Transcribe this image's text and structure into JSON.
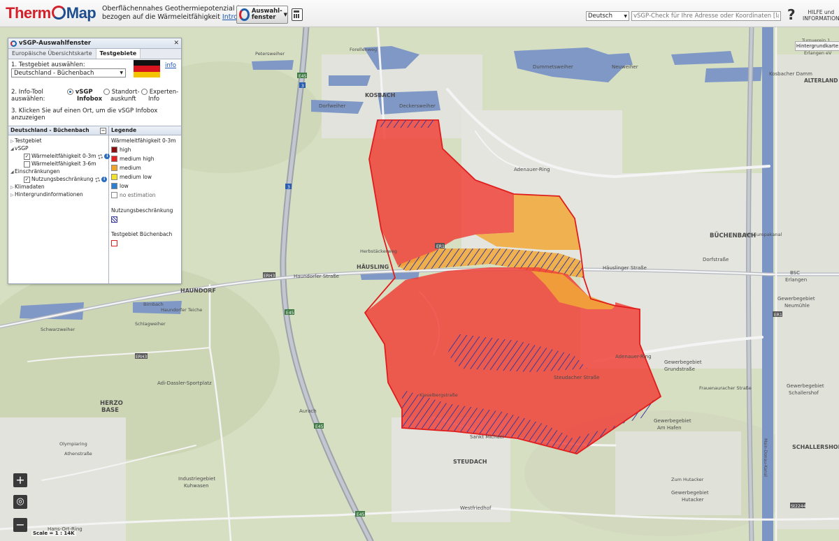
{
  "header": {
    "logo_part1": "Therm",
    "logo_part2": "Map",
    "subtitle_line1": "Oberflächennahes Geothermiepotenzial (vSGP)",
    "subtitle_line2": "bezogen auf die Wärmeleitfähigkeit",
    "intro_link": "Intro anzeigen",
    "auswahl_label_1": "Auswahl-",
    "auswahl_label_2": "fenster",
    "language": "Deutsch",
    "search_placeholder": "vSGP-Check für Ihre Adresse oder Koordinaten [lat,long]",
    "help_1": "HILFE und",
    "help_2": "INFORMATION",
    "background_map_button": "Hintergrundkarte"
  },
  "panel": {
    "title": "vSGP-Auswahlfenster",
    "tabs": [
      "Europäische Übersichtskarte",
      "Testgebiete"
    ],
    "step1": "1. Testgebiet auswählen:",
    "selected_area": "Deutschland - Büchenbach",
    "info_link": "info",
    "step2_a": "2. Info-Tool",
    "step2_b": "auswählen:",
    "tool_options": [
      {
        "l1": "vSGP",
        "l2": "Infobox"
      },
      {
        "l1": "Standort-",
        "l2": "auskunft"
      },
      {
        "l1": "Experten-",
        "l2": "Info"
      }
    ],
    "step3": "3. Klicken Sie auf einen Ort, um die vSGP Infobox anzuzeigen",
    "tree_title": "Deutschland - Büchenbach",
    "tree": {
      "testgebiet": "Testgebiet",
      "vsgp": "vSGP",
      "w03": "Wärmeleitfähigkeit 0-3m",
      "w36": "Wärmeleitfähigkeit 3-6m",
      "einschraenkungen": "Einschränkungen",
      "nutzung": "Nutzungsbeschränkung",
      "klimadaten": "Klimadaten",
      "hintergrund": "Hintergrundinformationen"
    },
    "legend_title": "Legende",
    "legend_subtitle": "Wärmeleitfähigkeit 0-3m",
    "legend_items": [
      {
        "label": "high",
        "color": "#8b0f0f"
      },
      {
        "label": "medium high",
        "color": "#e42222"
      },
      {
        "label": "medium",
        "color": "#f0a52a"
      },
      {
        "label": "medium low",
        "color": "#f3e22c"
      },
      {
        "label": "low",
        "color": "#2e7fd0"
      },
      {
        "label": "no estimation",
        "color": "#ffffff"
      }
    ],
    "legend_restriction": "Nutzungsbeschränkung",
    "legend_testarea": "Testgebiet Büchenbach"
  },
  "map": {
    "scale": "Scale = 1 : 14K",
    "labels": {
      "kosbach": "KOSBACH",
      "buechenbach": "BÜCHENBACH",
      "haeusling": "HÄUSLING",
      "haundorf": "HAUNDORF",
      "herzo": "HERZO",
      "base": "BASE",
      "steudach": "STEUDACH",
      "schallershof": "SCHALLERSHOF",
      "alterland": "ALTERLAND",
      "dorfweiher": "Dorfweiher",
      "deckersweiher": "Deckersweiher",
      "dummetsweiher": "Dummetsweiher",
      "neuweiher": "Neuweiher",
      "forellenweg": "Forellenweg",
      "petersweiher": "Petersweiher",
      "adenauer_ring": "Adenauer-Ring",
      "adenauer_ring2": "Adenauer-Ring",
      "kosbacher_damm": "Kosbacher Damm",
      "haundorfer_str": "Haundorfer Straße",
      "haeuslinger_str": "Häuslinger Straße",
      "dorfstrasse": "Dorfstraße",
      "steudacher_str": "Steudacher Straße",
      "sankt_michael": "Sankt Michael",
      "kiesweg": "Kieselbergstraße",
      "am_europakanal": "Am Europakanal",
      "frauenauracher_str": "Frauenauracher Straße",
      "adi_dassler": "Adi-Dassler-Sportplatz",
      "aurach": "Aurach",
      "industriegebiet": "Industriegebiet",
      "kuhwasen": "Kuhwasen",
      "gewerbegebiet_grund": "Gewerbegebiet",
      "grundstrasse": "Grundstraße",
      "gewerbegebiet_schall": "Gewerbegebiet",
      "schallershof_label": "Schallershof",
      "gewerbegebiet_hafen": "Gewerbegebiet",
      "am_hafen": "Am Hafen",
      "gewerbegebiet_neu": "Gewerbegebiet",
      "neumuehle": "Neumühle",
      "bsc": "BSC",
      "erlangen": "Erlangen",
      "westfriedhof": "Westfriedhof",
      "hutacker_1": "Gewerbegebiet",
      "hutacker_2": "Hutacker",
      "zum_hutacker": "Zum Hutacker",
      "olympiaring": "Olympiaring",
      "athenstrasse": "Athenstraße",
      "hans_ort": "Hans-Ort-Ring",
      "schwarzweiher": "Schwarzweiher",
      "birnbach": "Birnbach",
      "haundorfer_teiche": "Haundorfer Teiche",
      "schlagweiher": "Schlagweiher",
      "turnverein_1": "Turnverein 1",
      "turnverein_2": "1906",
      "turnverein_3": "Erlangen eV",
      "herbstaeckerweg": "Herbstäckerweg",
      "e45": "E45",
      "a3": "3",
      "erh3": "ERH3",
      "er1": "ER1",
      "st2244": "St2244",
      "main_donau": "Main-Donau-Kanal"
    }
  }
}
